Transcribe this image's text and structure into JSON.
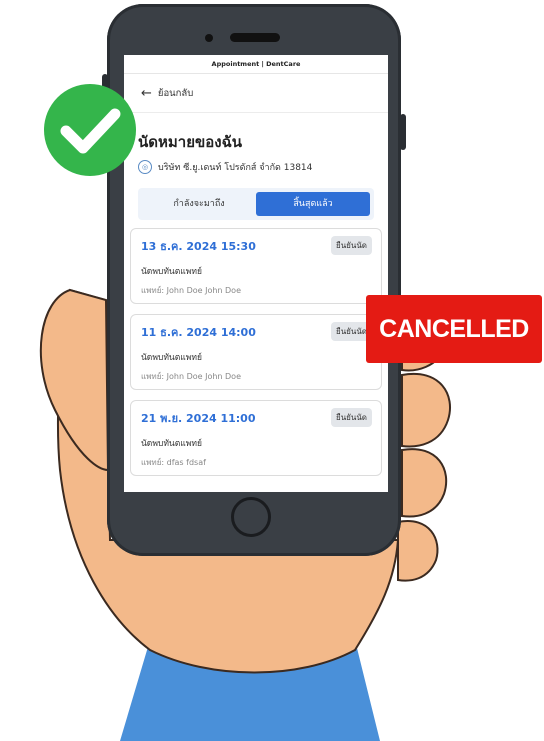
{
  "app_bar": {
    "title": "Appointment | DentCare"
  },
  "back": {
    "label": "ย้อนกลับ"
  },
  "page": {
    "title": "นัดหมายของฉัน",
    "clinic": "บริษัท ซี.ยู.เดนท์ โปรดักส์ จำกัด 13814"
  },
  "tabs": [
    {
      "label": "กำลังจะมาถึง",
      "active": false
    },
    {
      "label": "สิ้นสุดแล้ว",
      "active": true
    }
  ],
  "appointments": [
    {
      "datetime": "13 ธ.ค. 2024 15:30",
      "type": "นัดพบทันตแพทย์",
      "doctor": "แพทย์: John Doe John Doe",
      "status": "ยืนยันนัด"
    },
    {
      "datetime": "11 ธ.ค. 2024 14:00",
      "type": "นัดพบทันตแพทย์",
      "doctor": "แพทย์: John Doe John Doe",
      "status": "ยืนยันนัด"
    },
    {
      "datetime": "21 พ.ย. 2024 11:00",
      "type": "นัดพบทันตแพทย์",
      "doctor": "แพทย์: dfas fdsaf",
      "status": "ยืนยันนัด"
    }
  ],
  "overlay": {
    "stamp": "CANCELLED",
    "stamp_color": "#e41b14",
    "check_color": "#34b54b"
  },
  "colors": {
    "accent": "#2f6fd6",
    "skin": "#f3b98a",
    "sleeve": "#4a90d9"
  }
}
